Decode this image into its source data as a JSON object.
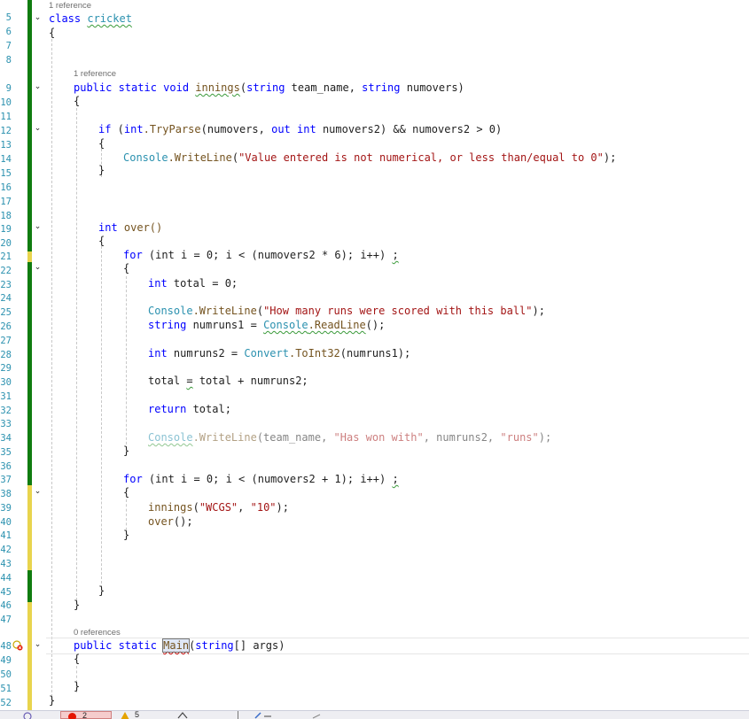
{
  "line_numbers": [
    "5",
    "6",
    "7",
    "8",
    "9",
    "10",
    "11",
    "12",
    "13",
    "14",
    "15",
    "16",
    "17",
    "18",
    "19",
    "20",
    "21",
    "22",
    "23",
    "24",
    "25",
    "26",
    "27",
    "28",
    "29",
    "30",
    "31",
    "32",
    "33",
    "34",
    "35",
    "36",
    "37",
    "38",
    "39",
    "40",
    "41",
    "42",
    "43",
    "44",
    "45",
    "46",
    "47",
    "48",
    "49",
    "50",
    "51",
    "52"
  ],
  "code_lens": {
    "cricket_refs": "1 reference",
    "innings_refs": "1 reference",
    "main_refs": "0 references"
  },
  "code": {
    "class_kw": "class",
    "class_name": "cricket",
    "open_brace": "{",
    "close_brace": "}",
    "innings_sig_kw": "public static void",
    "innings_name": "innings",
    "innings_params_1": "(",
    "string_kw": "string",
    "team_name": " team_name, ",
    "numovers_param": " numovers)",
    "if_kw": "if",
    "if_open": " (",
    "int_kw": "int",
    "tryparse": ".TryParse",
    "if_args_1": "(numovers, ",
    "out_kw": "out",
    "if_args_2": " numovers2) && numovers2 > 0)",
    "console": "Console",
    "writeline": ".WriteLine",
    "msg_not_numerical": "\"Value entered is not numerical, or less than/equal to 0\"",
    "paren_semi": ");",
    "over_name": " over()",
    "for_kw": "for",
    "for1_rest": " (int i = 0; i < (numovers2 * 6); i++) ",
    "semi": ";",
    "total_decl": " total = 0;",
    "msg_runs": "\"How many runs were scored with this ball\"",
    "numruns1_decl": " numruns1 = ",
    "readline": ".ReadLine",
    "readline_call": "();",
    "numruns2_decl": " numruns2 = ",
    "convert": "Convert",
    "toint32": ".ToInt32",
    "toint32_args": "(numruns1);",
    "total_assign_1": "total ",
    "eq": "=",
    "total_assign_2": " total + numruns2;",
    "return_kw": "return",
    "return_rest": " total;",
    "dim_line_args_1": "(team_name, ",
    "msg_has_won": "\"Has won with\"",
    "dim_line_args_2": ", numruns2, ",
    "msg_runs_word": "\"runs\"",
    "for2_rest": " (int i = 0; i < (numovers2 + 1); i++) ",
    "innings_call": "innings",
    "call_open": "(",
    "arg_wcgs": "\"WCGS\"",
    "comma": ", ",
    "arg_10": "\"10\"",
    "over_call": "over",
    "main_sig_kw": "public static",
    "main_name": "Main",
    "main_args_open": "(",
    "main_args_rest": "[] args)"
  },
  "status_bar": {
    "errors_count": "2",
    "warnings_count": "5"
  },
  "colors": {
    "keyword": "#0000ff",
    "type": "#2b91af",
    "string": "#a31515",
    "method": "#74531f",
    "line_number": "#2b91af",
    "change_saved": "#107c10",
    "change_unsaved": "#e8d44d"
  }
}
